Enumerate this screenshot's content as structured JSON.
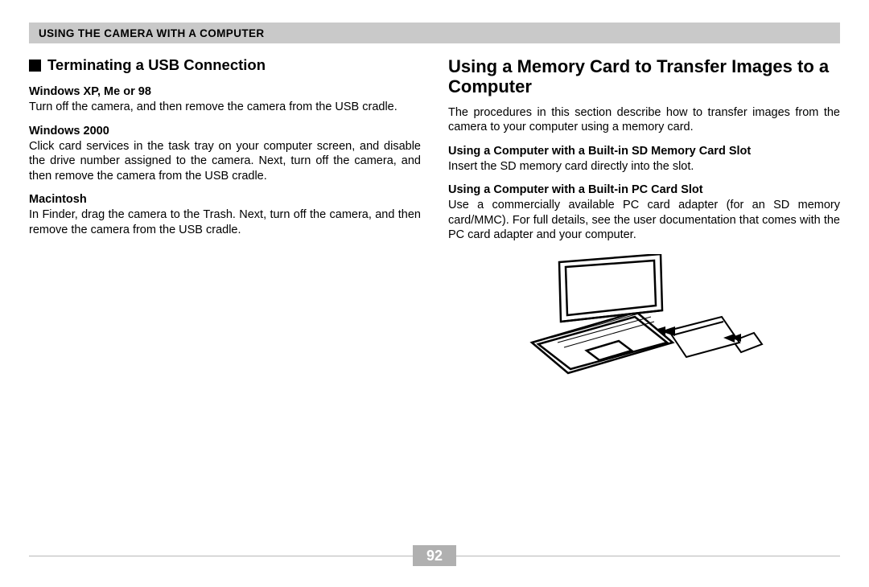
{
  "banner": "USING THE CAMERA WITH A COMPUTER",
  "left": {
    "heading": "Terminating a USB Connection",
    "sections": [
      {
        "title": "Windows XP, Me or 98",
        "body": "Turn off the camera, and then remove the camera from the USB cradle."
      },
      {
        "title": "Windows 2000",
        "body": "Click card services in the task tray on your computer screen, and disable the drive number assigned to the camera. Next, turn off the camera, and then remove the camera from the USB cradle."
      },
      {
        "title": "Macintosh",
        "body": "In Finder, drag the camera to the Trash. Next, turn off the camera, and then remove the camera from the USB cradle."
      }
    ]
  },
  "right": {
    "heading": "Using a Memory Card to Transfer Images to a Computer",
    "intro": "The procedures in this section describe how to transfer images from the camera to your computer using a memory card.",
    "sections": [
      {
        "title": "Using a Computer with a Built-in SD Memory Card Slot",
        "body": "Insert the SD memory card directly into the slot."
      },
      {
        "title": "Using a Computer with a Built-in PC Card Slot",
        "body": "Use a commercially available PC card adapter (for an SD memory card/MMC). For full details, see the user documentation that comes with the PC card adapter and your computer."
      }
    ]
  },
  "page_number": "92"
}
